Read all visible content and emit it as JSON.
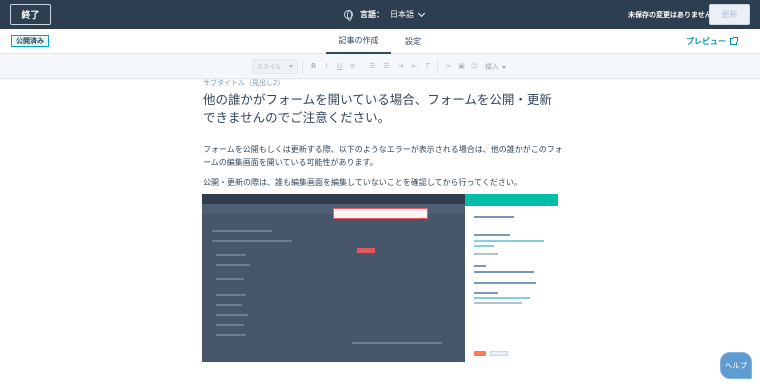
{
  "topbar": {
    "exit_label": "終了",
    "language_label": "言語：",
    "language_value": "日本語",
    "unsaved_text": "未保存の変更はありません",
    "update_label": "更新",
    "globe_icon": "globe-icon"
  },
  "subbar": {
    "status_badge": "公開済み",
    "tabs": [
      {
        "label": "記事の作成",
        "active": true
      },
      {
        "label": "設定",
        "active": false
      }
    ],
    "preview_label": "プレビュー"
  },
  "toolbar": {
    "style_placeholder": "スタイル",
    "insert_label": "挿入"
  },
  "article": {
    "subtitle_label": "サブタイトル（見出し2）",
    "heading": "他の誰かがフォームを開いている場合、フォームを公開・更新できませんのでご注意ください。",
    "paragraph1": "フォームを公開もしくは更新する際、以下のようなエラーが表示される場合は、他の誰かがこのフォームの編集画面を開いている可能性があります。",
    "paragraph2": "公開・更新の際は、誰も編集画面を編集していないことを確認してから行ってください。"
  },
  "help_label": "ヘルプ",
  "colors": {
    "topbar": "#2d3e50",
    "accent_link": "#0091ae",
    "teal": "#00bda5",
    "help_button": "#5e9bd1"
  }
}
